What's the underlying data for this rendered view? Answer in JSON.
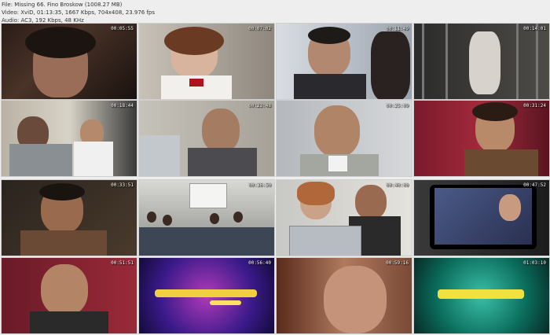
{
  "header": {
    "line1": "File: Missing 66. Fino Broskow (1008.27 MB)",
    "line2": "Video: XviD, 01:13:35, 1667 Kbps, 704x408, 23.976 fps",
    "line3": "Audio: AC3, 192 Kbps, 48 KHz"
  },
  "thumbnails": [
    {
      "time": "00:05:55",
      "scene": "woman-closeup-dark"
    },
    {
      "time": "00:07:02",
      "scene": "woman-in-school-uniform"
    },
    {
      "time": "00:11:49",
      "scene": "man-and-woman-in-office"
    },
    {
      "time": "00:14:01",
      "scene": "girl-behind-bars"
    },
    {
      "time": "00:18:44",
      "scene": "two-men-at-desk"
    },
    {
      "time": "00:23:48",
      "scene": "man-behind-monitor"
    },
    {
      "time": "00:25:09",
      "scene": "man-closeup-office"
    },
    {
      "time": "00:31:24",
      "scene": "man-with-glasses-red-curtain"
    },
    {
      "time": "00:33:51",
      "scene": "man-in-suit-dark"
    },
    {
      "time": "00:36:50",
      "scene": "office-meeting-room"
    },
    {
      "time": "00:40:00",
      "scene": "two-people-at-laptop"
    },
    {
      "time": "00:47:52",
      "scene": "woman-on-tv-screen"
    },
    {
      "time": "00:51:51",
      "scene": "man-red-curtain"
    },
    {
      "time": "00:56:40",
      "scene": "purple-sparkle-title"
    },
    {
      "time": "00:59:16",
      "scene": "skin-closeup"
    },
    {
      "time": "01:03:10",
      "scene": "green-sparkle-title"
    }
  ]
}
